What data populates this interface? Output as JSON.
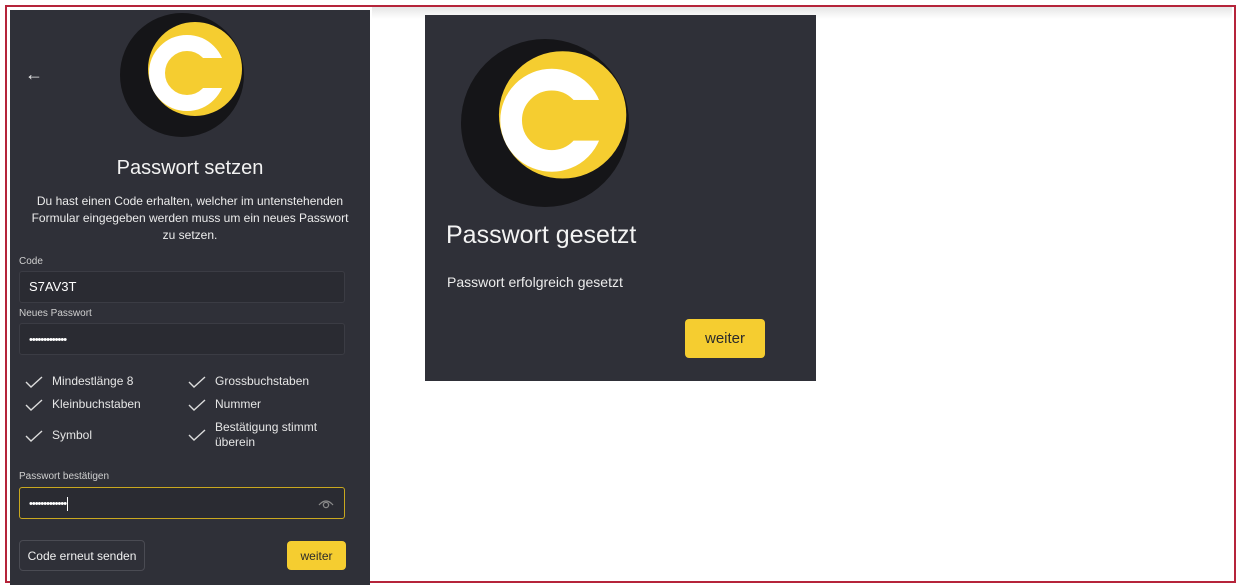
{
  "reset_form": {
    "back_icon": "arrow-left-icon",
    "logo_icon": "c-logo-icon",
    "title": "Passwort setzen",
    "description": "Du hast einen Code erhalten, welcher im untenstehenden Formular eingegeben werden muss um ein neues Passwort zu setzen.",
    "code": {
      "label": "Code",
      "value": "S7AV3T"
    },
    "new_password": {
      "label": "Neues Passwort",
      "masked_value": "•••••••••••••"
    },
    "requirements": [
      {
        "label": "Mindestlänge 8",
        "met": true
      },
      {
        "label": "Grossbuchstaben",
        "met": true
      },
      {
        "label": "Kleinbuchstaben",
        "met": true
      },
      {
        "label": "Nummer",
        "met": true
      },
      {
        "label": "Symbol",
        "met": true
      },
      {
        "label": "Bestätigung stimmt überein",
        "met": true
      }
    ],
    "confirm_password": {
      "label": "Passwort bestätigen",
      "masked_value": "•••••••••••••",
      "icon": "eye-icon"
    },
    "resend_button": "Code erneut senden",
    "continue_button": "weiter"
  },
  "success_dialog": {
    "logo_icon": "c-logo-icon",
    "title": "Passwort gesetzt",
    "message": "Passwort erfolgreich gesetzt",
    "continue_button": "weiter"
  },
  "colors": {
    "panel_bg": "#2f3038",
    "accent_yellow": "#f5cd30",
    "frame_border": "#b5243a"
  }
}
